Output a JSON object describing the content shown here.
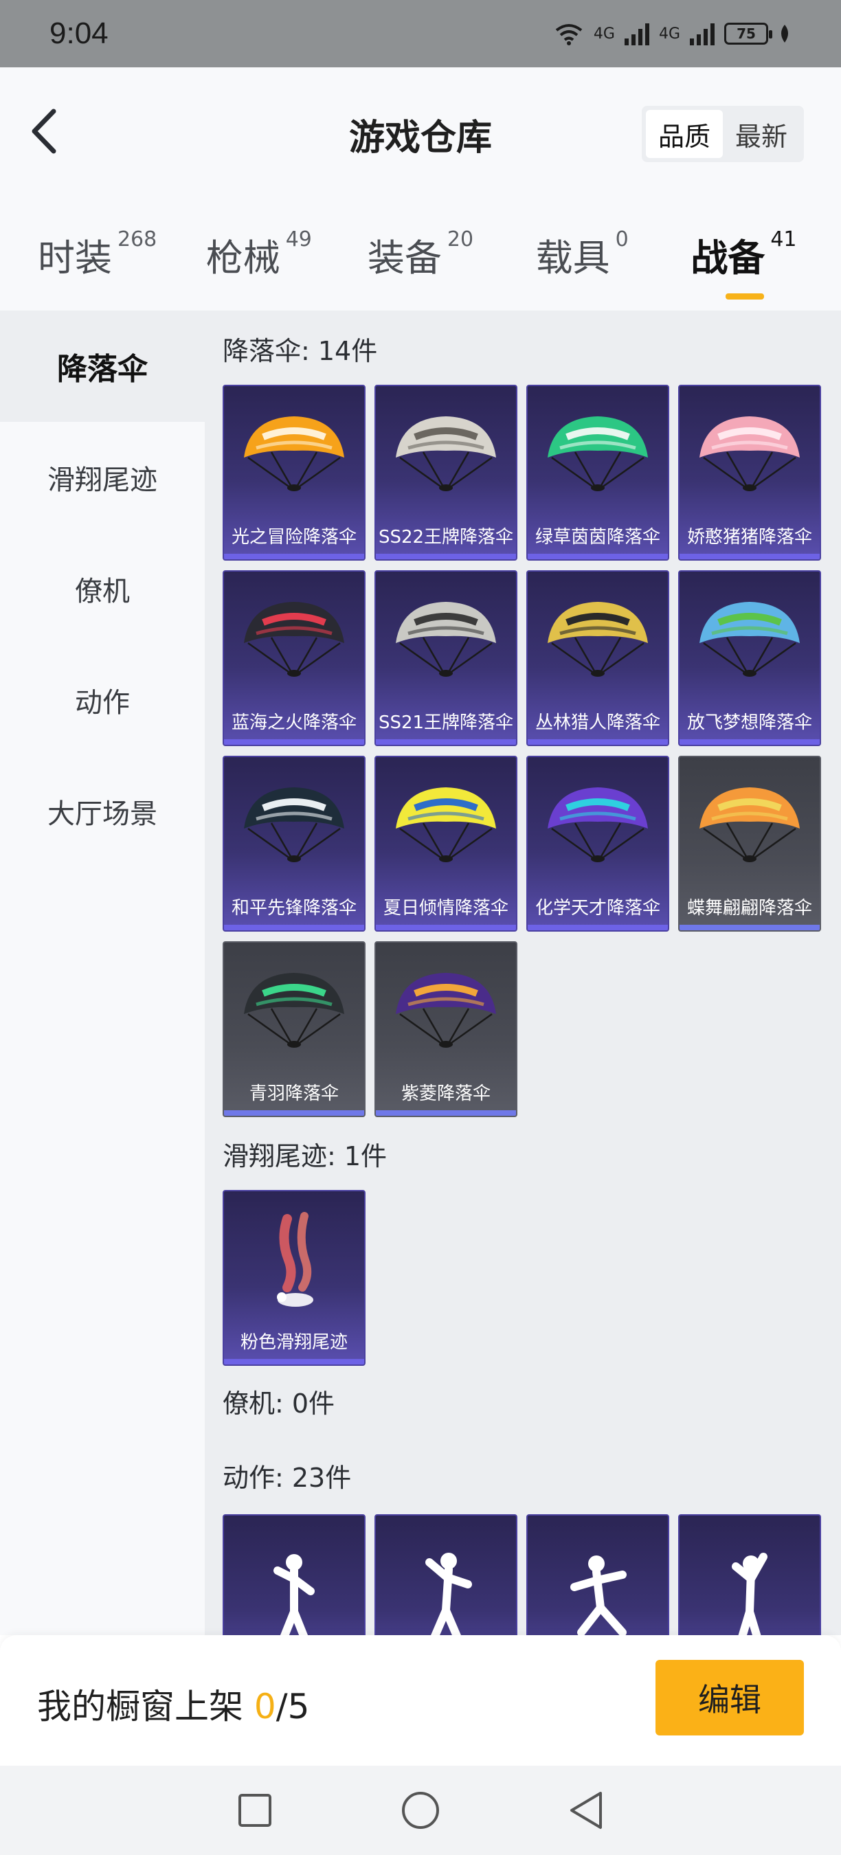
{
  "status_bar": {
    "time": "9:04",
    "network_1": "4G",
    "network_2": "4G",
    "battery": "75"
  },
  "header": {
    "title": "游戏仓库",
    "sort_options": [
      "品质",
      "最新"
    ]
  },
  "tabs": [
    {
      "label": "时装",
      "count": "268"
    },
    {
      "label": "枪械",
      "count": "49"
    },
    {
      "label": "装备",
      "count": "20"
    },
    {
      "label": "载具",
      "count": "0"
    },
    {
      "label": "战备",
      "count": "41"
    }
  ],
  "sidebar": {
    "items": [
      "降落伞",
      "滑翔尾迹",
      "僚机",
      "动作",
      "大厅场景"
    ]
  },
  "sections": {
    "parachute": {
      "title": "降落伞: 14件",
      "items": [
        {
          "name": "光之冒险降落伞",
          "colors": [
            "#f6a21a",
            "#fff1d6"
          ]
        },
        {
          "name": "SS22王牌降落伞",
          "colors": [
            "#d7d4cc",
            "#6b6760"
          ]
        },
        {
          "name": "绿草茵茵降落伞",
          "colors": [
            "#2cc784",
            "#e8f6ef"
          ]
        },
        {
          "name": "娇憨猪猪降落伞",
          "colors": [
            "#f4a8b8",
            "#ffe8ee"
          ]
        },
        {
          "name": "蓝海之火降落伞",
          "colors": [
            "#2a2a33",
            "#e23c4e"
          ]
        },
        {
          "name": "SS21王牌降落伞",
          "colors": [
            "#c9c9c4",
            "#3c3c3c"
          ]
        },
        {
          "name": "丛林猎人降落伞",
          "colors": [
            "#e0c04a",
            "#2a2a2a"
          ]
        },
        {
          "name": "放飞梦想降落伞",
          "colors": [
            "#5fb4e6",
            "#5cc34a"
          ]
        },
        {
          "name": "和平先锋降落伞",
          "colors": [
            "#1e2d3a",
            "#e9eef2"
          ]
        },
        {
          "name": "夏日倾情降落伞",
          "colors": [
            "#f2e93a",
            "#2e6ec8"
          ]
        },
        {
          "name": "化学天才降落伞",
          "colors": [
            "#6a3fd0",
            "#2fd0e0"
          ]
        },
        {
          "name": "蝶舞翩翩降落伞",
          "colors": [
            "#f59a3a",
            "#f2d65a"
          ]
        },
        {
          "name": "青羽降落伞",
          "colors": [
            "#2b2f33",
            "#3bd68a"
          ]
        },
        {
          "name": "紫菱降落伞",
          "colors": [
            "#4a2c8a",
            "#f2a63a"
          ]
        }
      ]
    },
    "glide_trail": {
      "title": "滑翔尾迹: 1件",
      "items": [
        {
          "name": "粉色滑翔尾迹"
        }
      ]
    },
    "wingman": {
      "title": "僚机: 0件"
    },
    "emote": {
      "title": "动作: 23件"
    }
  },
  "bottom": {
    "showcase_label": "我的橱窗上架 ",
    "showcase_count": "0",
    "showcase_total": "/5",
    "edit_label": "编辑"
  },
  "icons": {
    "back": "back-arrow-icon",
    "recent": "square-icon",
    "home": "circle-icon",
    "nav_back": "triangle-back-icon"
  }
}
